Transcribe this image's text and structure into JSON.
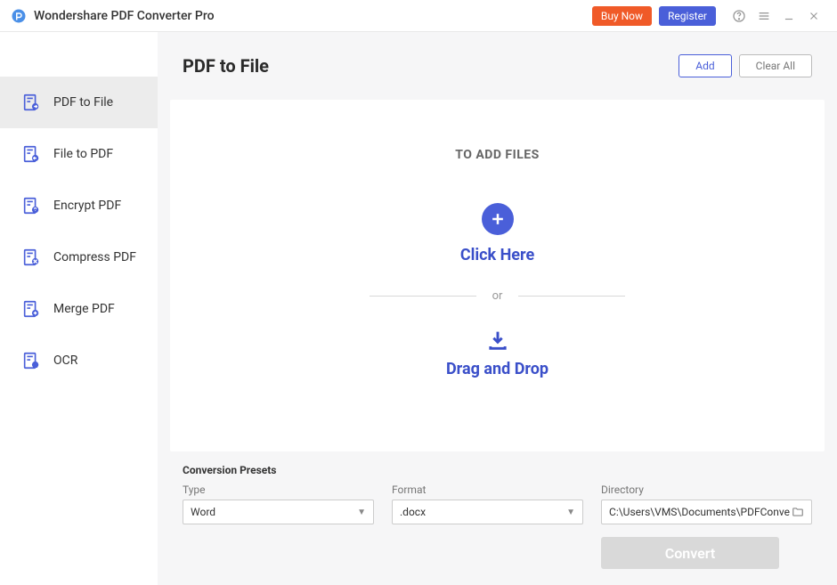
{
  "titlebar": {
    "app_name": "Wondershare PDF Converter Pro",
    "buy": "Buy Now",
    "register": "Register"
  },
  "sidebar": {
    "items": [
      {
        "label": "PDF to File"
      },
      {
        "label": "File to PDF"
      },
      {
        "label": "Encrypt PDF"
      },
      {
        "label": "Compress PDF"
      },
      {
        "label": "Merge PDF"
      },
      {
        "label": "OCR"
      }
    ]
  },
  "header": {
    "title": "PDF to File",
    "add": "Add",
    "clear": "Clear All"
  },
  "dropzone": {
    "heading": "TO ADD FILES",
    "click": "Click Here",
    "or": "or",
    "drag": "Drag and Drop"
  },
  "presets": {
    "title": "Conversion Presets",
    "type_label": "Type",
    "type_value": "Word",
    "format_label": "Format",
    "format_value": ".docx",
    "dir_label": "Directory",
    "dir_value": "C:\\Users\\VMS\\Documents\\PDFConve",
    "convert": "Convert"
  }
}
